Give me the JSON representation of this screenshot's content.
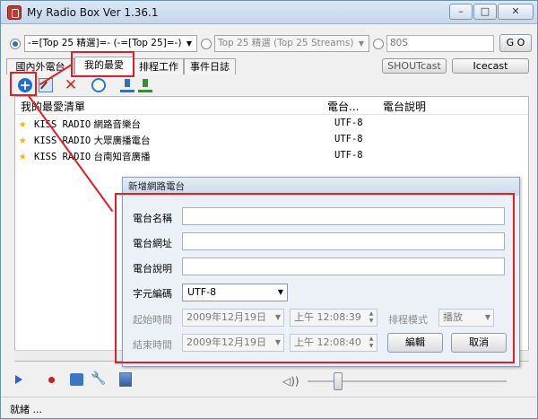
{
  "window": {
    "title": "My Radio Box Ver 1.36.1"
  },
  "window_controls": {
    "minimize": "–",
    "maximize": "□",
    "close": "✕"
  },
  "source_bar": {
    "combo_main": "-=[Top 25 精選]=- (-=[Top 25]=-)",
    "combo_streams": "Top 25 精選 (Top 25 Streams)",
    "search_value": "80S",
    "go_label": "G O"
  },
  "tabs": [
    "國內外電台",
    "我的最愛",
    "排程工作",
    "事件日誌"
  ],
  "directory_buttons": {
    "shoutcast": "SHOUTcast",
    "icecast": "Icecast"
  },
  "list": {
    "columns": [
      "我的最愛清單",
      "電台...",
      "電台說明"
    ],
    "rows": [
      {
        "prefix": "KISS RADIO",
        "name": " 網路音樂台",
        "encoding": "UTF-8"
      },
      {
        "prefix": "KISS RADIO",
        "name": " 大眾廣播電台",
        "encoding": "UTF-8"
      },
      {
        "prefix": "KISS RADIO",
        "name": " 台南知音廣播",
        "encoding": "UTF-8"
      }
    ]
  },
  "dialog": {
    "title": "新增網路電台",
    "labels": {
      "name": "電台名稱",
      "url": "電台網址",
      "description": "電台說明",
      "encoding": "字元編碼",
      "start": "起始時間",
      "end": "結束時間",
      "schedule_mode": "排程模式"
    },
    "encoding_value": "UTF-8",
    "start_date": "2009年12月19日",
    "start_time": "上午 12:08:39",
    "end_date": "2009年12月19日",
    "end_time": "上午 12:08:40",
    "schedule_value": "播放",
    "edit_button": "編輯",
    "cancel_button": "取消"
  },
  "status": {
    "text": "就緒 ..."
  },
  "colors": {
    "annotation_red": "#e21f26",
    "accent_blue": "#1f6fd1"
  }
}
